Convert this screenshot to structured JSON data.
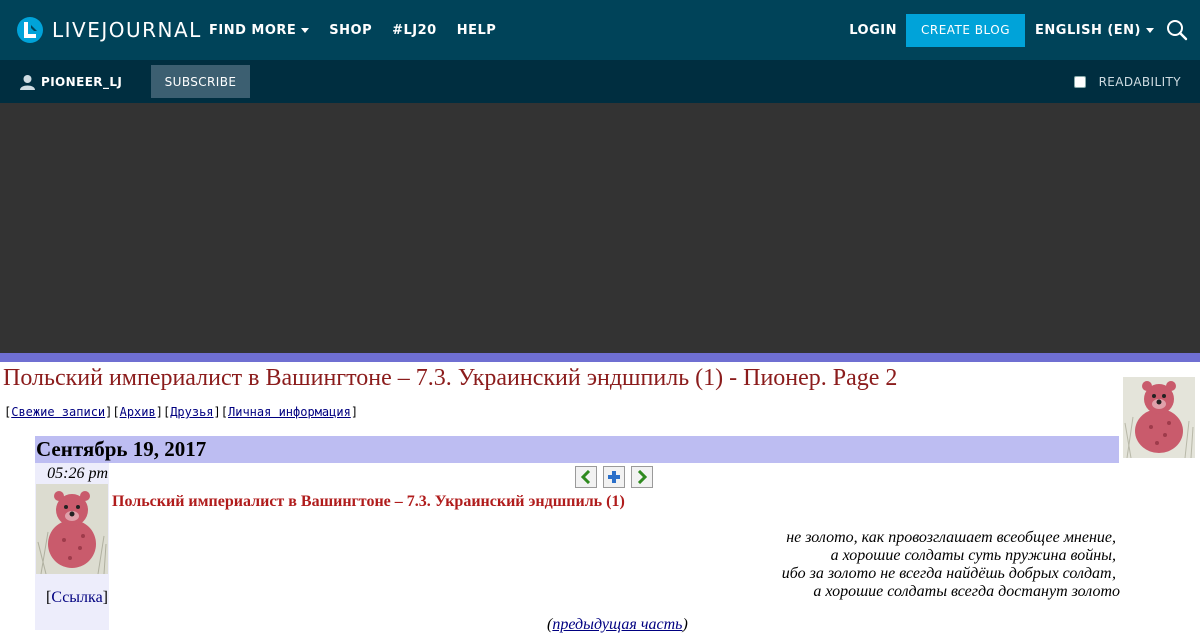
{
  "header": {
    "logo_text": "LIVEJOURNAL",
    "nav": [
      {
        "label": "FIND MORE",
        "has_dropdown": true
      },
      {
        "label": "SHOP",
        "has_dropdown": false
      },
      {
        "label": "#LJ20",
        "has_dropdown": false
      },
      {
        "label": "HELP",
        "has_dropdown": false
      }
    ],
    "login_label": "LOGIN",
    "create_blog_label": "CREATE BLOG",
    "language_label": "ENGLISH (EN)"
  },
  "subbar": {
    "username": "PIONEER_LJ",
    "subscribe_label": "SUBSCRIBE",
    "readability_label": "READABILITY",
    "readability_checked": false
  },
  "journal": {
    "title": "Польский империалист в Вашингтоне – 7.3. Украинский эндшпиль (1) - Пионер. Page 2",
    "links": [
      "Свежие записи",
      "Архив",
      "Друзья",
      "Личная информация"
    ]
  },
  "post": {
    "date": "Сентябрь 19, 2017",
    "time": "05:26 pm",
    "title": "Польский империалист в Вашингтоне – 7.3. Украинский эндшпиль (1)",
    "link_label": "Ссылка",
    "epigraph": [
      "не золото, как провозглашает всеобщее мнение,",
      "а хорошие солдаты суть пружина войны,",
      "ибо за золото не всегда найдёшь добрых солдат,",
      "а хорошие солдаты всегда достанут золото"
    ],
    "prev_part": "предыдущая часть"
  },
  "colors": {
    "topbar": "#004359",
    "subbar": "#002e40",
    "accent": "#00a3d9",
    "date_bar": "#bdbdf2",
    "title_red": "#8b1c1c"
  }
}
